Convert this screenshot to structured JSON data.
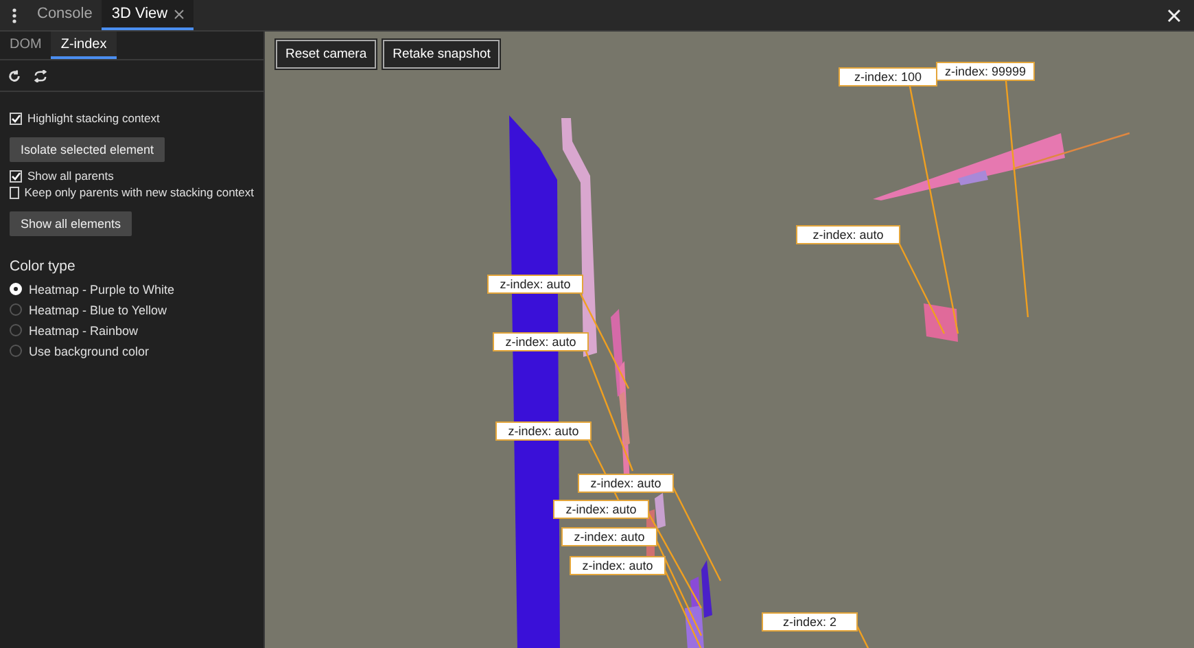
{
  "tabs": [
    {
      "label": "Console",
      "selected": false,
      "closable": false
    },
    {
      "label": "3D View",
      "selected": true,
      "closable": true
    }
  ],
  "subtabs": [
    {
      "label": "DOM",
      "selected": false
    },
    {
      "label": "Z-index",
      "selected": true
    }
  ],
  "options": [
    {
      "kind": "checkbox",
      "label": "Highlight stacking context",
      "checked": true
    },
    {
      "kind": "button",
      "label": "Isolate selected element"
    },
    {
      "kind": "checkbox",
      "label": "Show all parents",
      "checked": true
    },
    {
      "kind": "checkbox",
      "label": "Keep only parents with new stacking context",
      "checked": false
    },
    {
      "kind": "button",
      "label": "Show all elements"
    }
  ],
  "color_type": {
    "heading": "Color type",
    "options": [
      {
        "label": "Heatmap - Purple to White",
        "selected": true
      },
      {
        "label": "Heatmap - Blue to Yellow",
        "selected": false
      },
      {
        "label": "Heatmap - Rainbow",
        "selected": false
      },
      {
        "label": "Use background color",
        "selected": false
      }
    ]
  },
  "viewport": {
    "buttons": [
      "Reset camera",
      "Retake snapshot"
    ],
    "labels": [
      "z-index: 100",
      "z-index: 99999",
      "z-index: auto",
      "z-index: auto",
      "z-index: auto",
      "z-index: auto",
      "z-index: auto",
      "z-index: auto",
      "z-index: auto",
      "z-index: auto",
      "z-index: 2"
    ]
  }
}
